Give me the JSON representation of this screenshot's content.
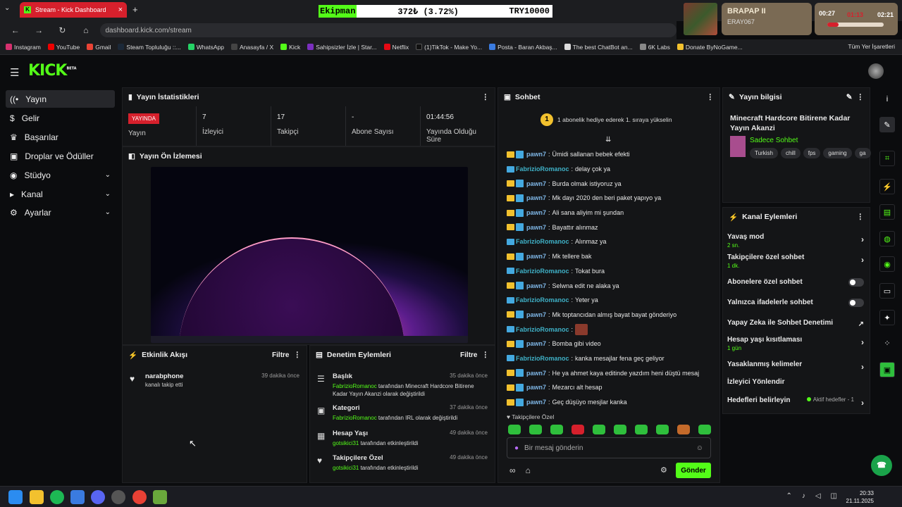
{
  "browser": {
    "tab_title": "Stream - Kick Dashboard",
    "url": "dashboard.kick.com/stream",
    "all_bookmarks": "Tüm Yer İşaretleri",
    "bookmarks": [
      "Instagram",
      "YouTube",
      "Gmail",
      "Steam Topluluğu ::...",
      "WhatsApp",
      "Anasayfa / X",
      "Kick",
      "Sahipsizler İzle | Star...",
      "Netflix",
      "(1)TikTok - Make Yo...",
      "Posta - Baran Akbaş...",
      "The best ChatBot an...",
      "6K Labs",
      "Donate ByNoGame..."
    ]
  },
  "overlay": {
    "ticker_symbol": "Ekipman",
    "ticker_price": "372₺ (3.72%)",
    "ticker_target": "TRY10000",
    "card_name": "BRAPAP II",
    "card_user": "ERAY067",
    "timer_left": "00:27",
    "timer_mid": "01:13",
    "timer_right": "02:21",
    "timer_progress": 0.2
  },
  "sidebar": {
    "items": [
      {
        "label": "Yayın",
        "icon": "broadcast-icon"
      },
      {
        "label": "Gelir",
        "icon": "dollar-icon"
      },
      {
        "label": "Başarılar",
        "icon": "trophy-icon"
      },
      {
        "label": "Droplar ve Ödüller",
        "icon": "gift-icon"
      },
      {
        "label": "Stüdyo",
        "icon": "studio-icon"
      },
      {
        "label": "Kanal",
        "icon": "channel-icon"
      },
      {
        "label": "Ayarlar",
        "icon": "gear-icon"
      }
    ]
  },
  "stats": {
    "title": "Yayın İstatistikleri",
    "live_badge": "YAYINDA",
    "status_label": "Yayın",
    "viewers_value": "7",
    "viewers_label": "İzleyici",
    "followers_value": "17",
    "followers_label": "Takipçi",
    "subs_value": "-",
    "subs_label": "Abone Sayısı",
    "uptime_value": "01:44:56",
    "uptime_label": "Yayında Olduğu Süre"
  },
  "preview": {
    "title": "Yayın Ön İzlemesi"
  },
  "activity": {
    "title": "Etkinlik Akışı",
    "filter": "Filtre",
    "items": [
      {
        "name": "narabphone",
        "desc": "kanalı takip etti",
        "time": "39 dakika önce"
      }
    ]
  },
  "moderation": {
    "title": "Denetim Eylemleri",
    "filter": "Filtre",
    "items": [
      {
        "title": "Başlık",
        "actor": "FabrizioRomanoc",
        "text": " tarafından Minecraft Hardcore Bitirene Kadar Yayın Akanzi olarak değiştirildi",
        "time": "35 dakika önce"
      },
      {
        "title": "Kategori",
        "actor": "FabrizioRomanoc",
        "text": " tarafından IRL olarak değiştirildi",
        "time": "37 dakika önce"
      },
      {
        "title": "Hesap Yaşı",
        "actor": "gotsikici31",
        "text": " tarafından etkinleştirildi",
        "time": "49 dakika önce"
      },
      {
        "title": "Takipçilere Özel",
        "actor": "gotsikici31",
        "text": " tarafından etkinleştirildi",
        "time": "49 dakika önce"
      }
    ]
  },
  "chat": {
    "title": "Sohbet",
    "pinned": "1 abonelik hediye ederek 1. sıraya yükselin",
    "pinned_num": "1",
    "messages": [
      {
        "user": "pawn7",
        "badges": 2,
        "text": "Ümidi sallanan bebek efekti"
      },
      {
        "user": "FabrizioRomanoc",
        "badges": 1,
        "text": "delay çok ya"
      },
      {
        "user": "pawn7",
        "badges": 2,
        "text": "Burda olmak istiyoruz ya"
      },
      {
        "user": "pawn7",
        "badges": 2,
        "text": "Mk dayı 2020 den beri paket yapıyo ya"
      },
      {
        "user": "pawn7",
        "badges": 2,
        "text": "Ali sana aliyim mi şundan"
      },
      {
        "user": "pawn7",
        "badges": 2,
        "text": "Bayattır alınmaz"
      },
      {
        "user": "FabrizioRomanoc",
        "badges": 1,
        "text": "Alınmaz ya"
      },
      {
        "user": "pawn7",
        "badges": 2,
        "text": "Mk tellere bak"
      },
      {
        "user": "FabrizioRomanoc",
        "badges": 1,
        "text": "Tokat bura"
      },
      {
        "user": "pawn7",
        "badges": 2,
        "text": "Selwna edit ne alaka ya"
      },
      {
        "user": "FabrizioRomanoc",
        "badges": 1,
        "text": "Yeter ya"
      },
      {
        "user": "pawn7",
        "badges": 2,
        "text": "Mk toptancıdan almış bayat bayat gönderiyo"
      },
      {
        "user": "FabrizioRomanoc",
        "badges": 1,
        "text": ""
      },
      {
        "user": "pawn7",
        "badges": 2,
        "text": "Bomba gibi video"
      },
      {
        "user": "FabrizioRomanoc",
        "badges": 1,
        "text": "kanka mesajlar fena geç geliyor"
      },
      {
        "user": "pawn7",
        "badges": 2,
        "text": "He ya ahmet kaya editinde yazdım heni düştü mesaj"
      },
      {
        "user": "pawn7",
        "badges": 2,
        "text": "Mezarcı alt hesap"
      },
      {
        "user": "pawn7",
        "badges": 2,
        "text": "Geç düşüyo mesjlar kanka"
      }
    ],
    "follow_only": "Takipçilere Özel",
    "placeholder": "Bir mesaj gönderin",
    "send": "Gönder"
  },
  "info": {
    "title": "Yayın bilgisi",
    "stream_title": "Minecraft Hardcore Bitirene Kadar Yayın Akanzi",
    "category": "Sadece Sohbet",
    "tags": [
      "Turkish",
      "chill",
      "fps",
      "gaming",
      "ga"
    ]
  },
  "actions": {
    "title": "Kanal Eylemleri",
    "slow": "Yavaş mod",
    "slow_val": "2 sn.",
    "followers_chat": "Takipçilere özel sohbet",
    "followers_val": "1 dk.",
    "subs_chat": "Abonelere özel sohbet",
    "emote_chat": "Yalnızca ifadelerle sohbet",
    "ai_mod": "Yapay Zeka ile Sohbet Denetimi",
    "account_age": "Hesap yaşı kısıtlaması",
    "account_age_val": "1 gün",
    "banned_words": "Yasaklanmış kelimeler",
    "redirect": "İzleyici Yönlendir",
    "goals": "Hedefleri belirleyin",
    "goals_status": "Aktif hedefler - 1"
  },
  "taskbar": {
    "time": "20:33",
    "date": "21.11.2025"
  }
}
